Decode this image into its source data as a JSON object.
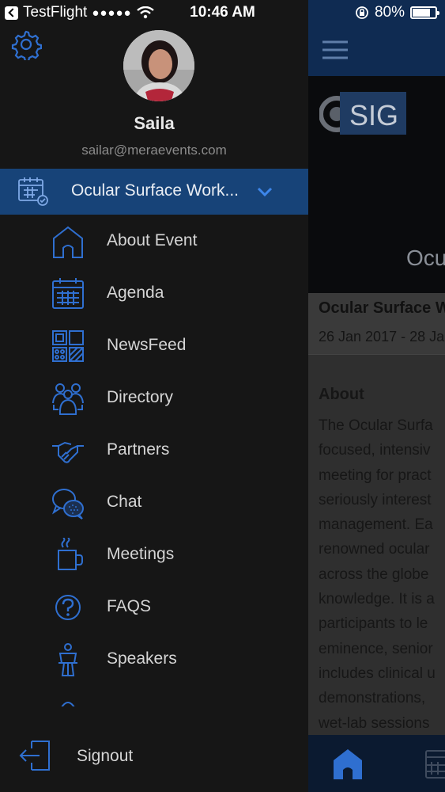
{
  "status_bar": {
    "app_back": "TestFlight",
    "signal": "●●●●●",
    "time": "10:46 AM",
    "battery_percent": "80%",
    "battery_level": 0.8
  },
  "drawer": {
    "user": {
      "name": "Saila",
      "email": "sailar@meraevents.com"
    },
    "event_selector": {
      "title": "Ocular Surface Work...",
      "icon": "calendar-icon",
      "chevron": "chevron-down-icon"
    },
    "menu": [
      {
        "label": "About Event",
        "icon": "home-icon"
      },
      {
        "label": "Agenda",
        "icon": "calendar-icon"
      },
      {
        "label": "NewsFeed",
        "icon": "grid-icon"
      },
      {
        "label": "Directory",
        "icon": "people-icon"
      },
      {
        "label": "Partners",
        "icon": "handshake-icon"
      },
      {
        "label": "Chat",
        "icon": "chat-icon"
      },
      {
        "label": "Meetings",
        "icon": "coffee-icon"
      },
      {
        "label": "FAQS",
        "icon": "question-icon"
      },
      {
        "label": "Speakers",
        "icon": "speaker-icon"
      }
    ],
    "signout": {
      "label": "Signout",
      "icon": "signout-icon"
    }
  },
  "background_screen": {
    "banner_title": "Ocu",
    "event_title": "Ocular Surface W",
    "event_dates": "26 Jan 2017 - 28 Ja",
    "about_heading": "About",
    "about_lines": [
      "The Ocular Surfa",
      "focused, intensiv",
      "meeting for pract",
      "seriously interest",
      "management. Ea",
      "renowned ocular",
      "across the globe",
      "knowledge. It is a",
      "participants to le",
      "eminence, senior",
      "includes clinical u",
      "demonstrations,",
      "wet-lab sessions"
    ]
  },
  "colors": {
    "accent": "#2f6fd0",
    "event_bar": "#174378",
    "drawer_bg": "#161616"
  }
}
